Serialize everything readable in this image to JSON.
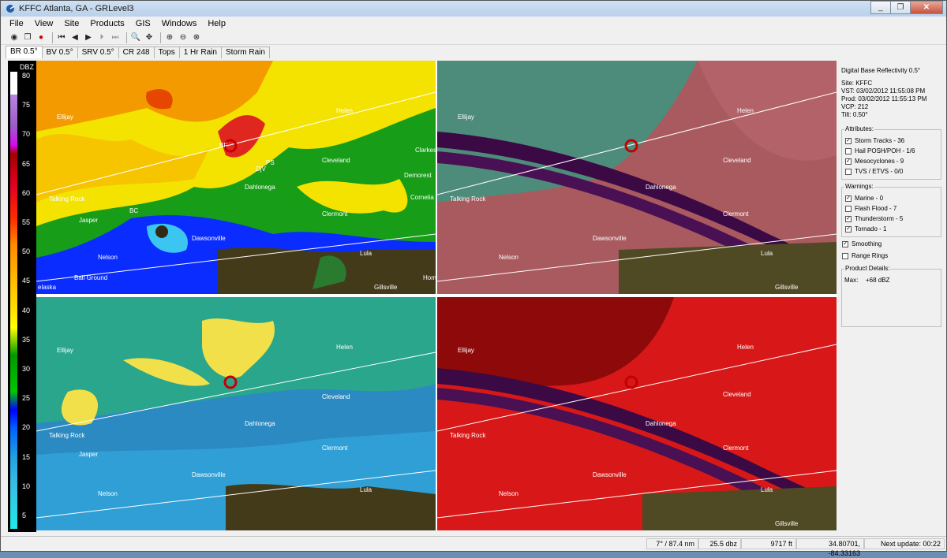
{
  "window": {
    "title": "KFFC Atlanta, GA - GRLevel3",
    "controls": [
      "_",
      "❐",
      "✕"
    ]
  },
  "menu": [
    "File",
    "View",
    "Site",
    "Products",
    "GIS",
    "Windows",
    "Help"
  ],
  "toolbar": {
    "icons": [
      "open-icon",
      "copy-icon",
      "record-icon",
      "first-frame-icon",
      "prev-frame-icon",
      "play-icon",
      "next-frame-icon",
      "last-frame-icon",
      "zoom-icon",
      "pan-icon",
      "zoom-in-icon",
      "zoom-out-icon",
      "zoom-reset-icon"
    ]
  },
  "tabs": [
    "BR 0.5°",
    "BV 0.5°",
    "SRV 0.5°",
    "CR 248",
    "Tops",
    "1 Hr Rain",
    "Storm Rain"
  ],
  "colorbar": {
    "unit": "DBZ",
    "ticks": [
      "80",
      "75",
      "70",
      "65",
      "60",
      "55",
      "50",
      "45",
      "40",
      "35",
      "30",
      "25",
      "20",
      "15",
      "10",
      "5"
    ]
  },
  "cities": [
    "Ellijay",
    "Helen",
    "Clarkesv",
    "Cleveland",
    "Demorest",
    "PS",
    "DjV",
    "Dahlonega",
    "Talking Rock",
    "Cornelia",
    "BC",
    "Jasper",
    "Clermont",
    "Dawsonville",
    "Nelson",
    "Lula",
    "Ball Ground",
    "Gillsville",
    "Hom",
    "elaska",
    "BF"
  ],
  "info": {
    "product": "Digital Base Reflectivity 0.5°",
    "site": "Site:  KFFC",
    "vst": "VST:  03/02/2012  11:55:08 PM",
    "prod": "Prod: 03/02/2012  11:55:13 PM",
    "vcp": "VCP:  212",
    "tilt": "Tilt:  0.50°"
  },
  "attributes": {
    "title": "Attributes:",
    "items": [
      {
        "label": "Storm Tracks - 36",
        "checked": true
      },
      {
        "label": "Hail POSH/POH - 1/6",
        "checked": false
      },
      {
        "label": "Mesocyclones - 9",
        "checked": true
      },
      {
        "label": "TVS / ETVS - 0/0",
        "checked": false
      }
    ]
  },
  "warnings": {
    "title": "Warnings:",
    "items": [
      {
        "label": "Marine - 0",
        "checked": true
      },
      {
        "label": "Flash Flood - 7",
        "checked": false
      },
      {
        "label": "Thunderstorm - 5",
        "checked": true
      },
      {
        "label": "Tornado - 1",
        "checked": true
      }
    ]
  },
  "options": [
    {
      "label": "Smoothing",
      "checked": true
    },
    {
      "label": "Range Rings",
      "checked": false
    }
  ],
  "details": {
    "title": "Product Details:",
    "max_label": "Max:",
    "max_value": "+68 dBZ"
  },
  "status": {
    "azimuth": "7° / 87.4 nm",
    "value": "25.5 dbz",
    "height": "9717 ft",
    "coords": "34.80701, -84.33163",
    "next_update": "Next update: 00:22"
  },
  "panel_colors": {
    "reflectivity": "#1a9a1a",
    "velocity": "#5a7a70",
    "srv_bg": "#2aa68c",
    "rain": "#a80000"
  }
}
